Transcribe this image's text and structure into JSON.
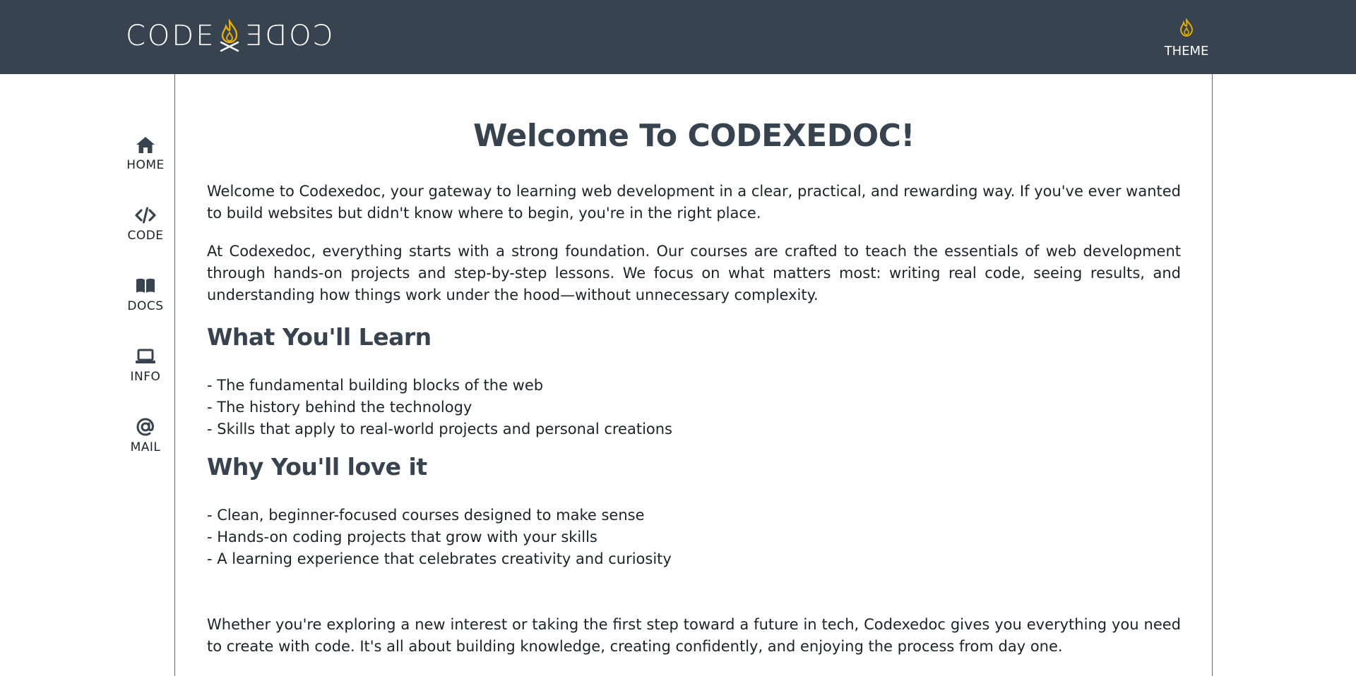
{
  "header": {
    "logo": {
      "left": "CODE",
      "right": "CODE"
    },
    "theme_label": "THEME",
    "colors": {
      "bar": "#37444f",
      "accent": "#f0b400"
    }
  },
  "sidebar": {
    "items": [
      {
        "label": "HOME",
        "icon": "home-icon"
      },
      {
        "label": "CODE",
        "icon": "code-icon"
      },
      {
        "label": "DOCS",
        "icon": "book-icon"
      },
      {
        "label": "INFO",
        "icon": "laptop-icon"
      },
      {
        "label": "MAIL",
        "icon": "at-icon"
      }
    ]
  },
  "main": {
    "title": "Welcome To CODEXEDOC!",
    "intro": "Welcome to Codexedoc, your gateway to learning web development in a clear, practical, and rewarding way. If you've ever wanted to build websites but didn't know where to begin, you're in the right place.",
    "foundation": "At Codexedoc, everything starts with a strong foundation. Our courses are crafted to teach the essentials of web development through hands-on projects and step-by-step lessons. We focus on what matters most: writing real code, seeing results, and understanding how things work under the hood—without unnecessary complexity.",
    "learn_heading": "What You'll Learn",
    "learn_items": [
      "- The fundamental building blocks of the web",
      "- The history behind the technology",
      "- Skills that apply to real-world projects and personal creations"
    ],
    "love_heading": "Why You'll love it",
    "love_items": [
      "- Clean, beginner-focused courses designed to make sense",
      "- Hands-on coding projects that grow with your skills",
      "- A learning experience that celebrates creativity and curiosity"
    ],
    "closing": "Whether you're exploring a new interest or taking the first step toward a future in tech, Codexedoc gives you everything you need to create with code. It's all about building knowledge, creating confidently, and enjoying the process from day one."
  }
}
